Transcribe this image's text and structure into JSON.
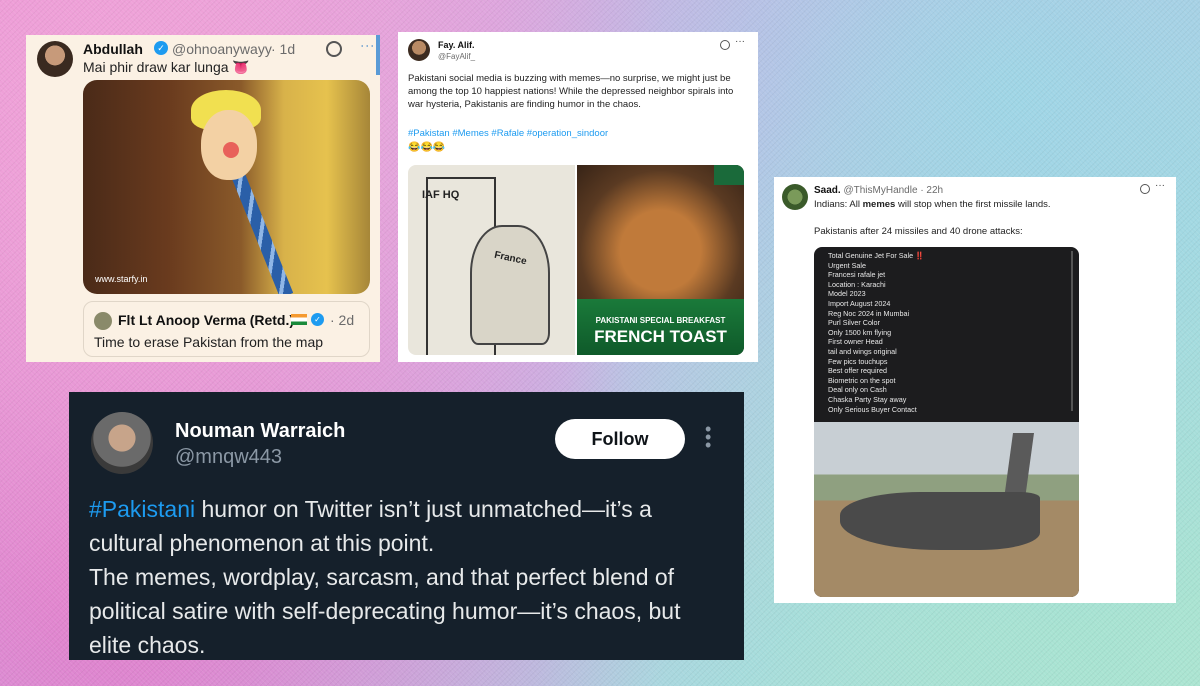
{
  "card1": {
    "name": "Abdullah",
    "handle": "@ohnoanywayy",
    "time": "· 1d",
    "text": "Mai phir draw kar lunga 👅",
    "media_watermark": "www.starfy.in",
    "quote": {
      "name": "Flt Lt Anoop Verma (Retd.)",
      "time": "· 2d",
      "text": "Time to erase Pakistan from the map"
    }
  },
  "card2": {
    "name": "Fay. Alif.",
    "handle": "@FayAlif_",
    "text": "Pakistani social media is buzzing with memes—no surprise, we might just be among the top 10 happiest nations! While the depressed neighbor spirals into war hysteria, Pakistanis are finding humor in the chaos.",
    "hashtags": "#Pakistan #Memes #Rafale #operation_sindoor",
    "emoji": "😂😂😂",
    "meme1_sign": "IAF HQ",
    "meme1_label": "France",
    "meme2_line1": "PAKISTANI SPECIAL BREAKFAST",
    "meme2_line2": "FRENCH TOAST"
  },
  "card3": {
    "name": "Saad.",
    "handle": "@ThisMyHandle",
    "time": "· 22h",
    "line1_a": "Indians: All ",
    "line1_b": "memes",
    "line1_c": " will stop when the first missile lands.",
    "line2": "Pakistanis after 24 missiles and 40 drone attacks:",
    "ad_lines": [
      "Total Genuine Jet For Sale ‼️",
      "Urgent Sale",
      "Francesi rafale jet",
      "Location : Karachi",
      "Model 2023",
      "Import August 2024",
      "Reg Noc 2024 in Mumbai",
      "Purl Silver Color",
      "Only 1500 km flying",
      "First owner Head",
      "tail and wings original",
      "Few pics touchups",
      "Best offer required",
      "Biometric on the spot",
      "Deal only on Cash",
      "Chaska Party Stay away",
      "Only Serious Buyer Contact"
    ]
  },
  "card4": {
    "name": "Nouman Warraich",
    "handle": "@mnqw443",
    "follow_label": "Follow",
    "hashtag": "#Pakistani",
    "body_1": " humor on Twitter isn’t just unmatched—it’s a cultural phenomenon at this point.",
    "body_2": "The memes, wordplay, sarcasm, and that perfect blend of political satire with self-deprecating humor—it’s chaos, but elite chaos."
  }
}
